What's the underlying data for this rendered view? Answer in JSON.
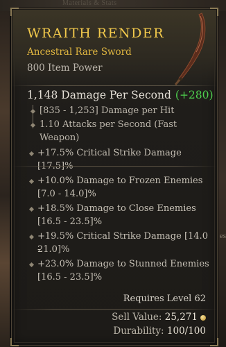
{
  "background": {
    "top_text": "Materials & Stats",
    "right_text": "es"
  },
  "item": {
    "name": "WRAITH RENDER",
    "type": "Ancestral Rare Sword",
    "power": "800 Item Power",
    "icon": "curved-sword-icon"
  },
  "damage": {
    "dps": "1,148 Damage Per Second",
    "dps_delta": "(+280)",
    "per_hit": "[835 - 1,253] Damage per Hit",
    "attack_speed_line1": "1.10 Attacks per Second (Fast",
    "attack_speed_line2": "Weapon)"
  },
  "implicit": {
    "text": "+17.5% Critical Strike Damage [17.5]%"
  },
  "affixes": [
    {
      "line1": "+10.0% Damage to Frozen Enemies",
      "line2": "[7.0 - 14.0]%"
    },
    {
      "line1": "+18.5% Damage to Close Enemies",
      "line2": "[16.5 - 23.5]%"
    },
    {
      "line1": "+19.5% Critical Strike Damage [14.0 -",
      "line2": "21.0]%"
    },
    {
      "line1": "+23.0% Damage to Stunned Enemies",
      "line2": "[16.5 - 23.5]%"
    }
  ],
  "requirements": "Requires Level 62",
  "sell": {
    "label": "Sell Value:",
    "value": "25,271"
  },
  "durability": {
    "label": "Durability:",
    "value": "100/100"
  },
  "colors": {
    "title": "#f2c94c",
    "rare": "#e0b640",
    "positive_delta": "#4ed14e"
  }
}
